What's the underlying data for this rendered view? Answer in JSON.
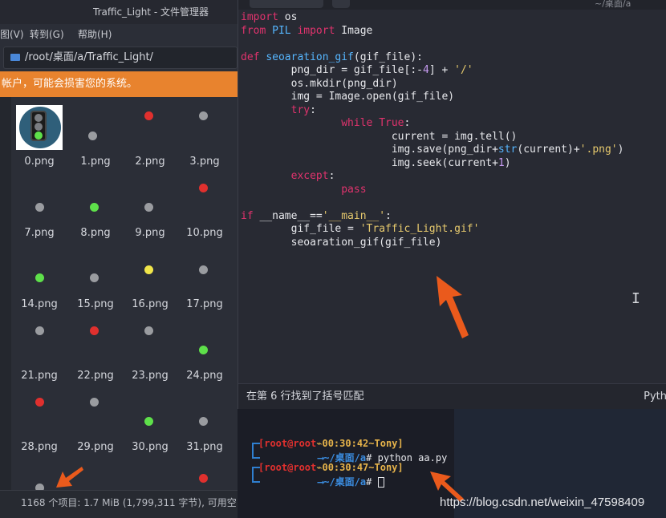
{
  "file_manager": {
    "title": "Traffic_Light - 文件管理器",
    "menu": [
      "图(V)",
      "转到(G)",
      "帮助(H)"
    ],
    "path": "/root/桌面/a/Traffic_Light/",
    "warning": "帐户，可能会损害您的系统。",
    "files": [
      {
        "name": "0.png",
        "thumb": "traffic-light"
      },
      {
        "name": "1.png",
        "dot": "gray"
      },
      {
        "name": "2.png",
        "dot": "red"
      },
      {
        "name": "3.png",
        "dot": "gray"
      },
      {
        "name": "7.png",
        "dot": "gray"
      },
      {
        "name": "8.png",
        "dot": "green"
      },
      {
        "name": "9.png",
        "dot": "gray"
      },
      {
        "name": "10.png",
        "dot": "red"
      },
      {
        "name": "14.png",
        "dot": "green"
      },
      {
        "name": "15.png",
        "dot": "gray"
      },
      {
        "name": "16.png",
        "dot": "yellow"
      },
      {
        "name": "17.png",
        "dot": "gray"
      },
      {
        "name": "21.png",
        "dot": "gray"
      },
      {
        "name": "22.png",
        "dot": "red"
      },
      {
        "name": "23.png",
        "dot": "gray"
      },
      {
        "name": "24.png",
        "dot": "green"
      },
      {
        "name": "28.png",
        "dot": "red"
      },
      {
        "name": "29.png",
        "dot": "gray"
      },
      {
        "name": "30.png",
        "dot": "green"
      },
      {
        "name": "31.png",
        "dot": "gray"
      }
    ],
    "status": "1168 个项目: 1.7 MiB (1,799,311 字节), 可用空"
  },
  "colors": {
    "gray": "#9a9ca0",
    "red": "#e0302e",
    "green": "#5ee04a",
    "yellow": "#f1e64a",
    "warning_bg": "#e8832e"
  },
  "editor": {
    "path_hint": "~/桌面/a",
    "code": [
      [
        [
          "kw",
          "import"
        ],
        [
          "t",
          " os"
        ]
      ],
      [
        [
          "kw",
          "from"
        ],
        [
          "t",
          " "
        ],
        [
          "bi",
          "PIL"
        ],
        [
          "t",
          " "
        ],
        [
          "kw",
          "import"
        ],
        [
          "t",
          " Image"
        ]
      ],
      [],
      [
        [
          "kw",
          "def"
        ],
        [
          "t",
          " "
        ],
        [
          "fn",
          "seoaration_gif"
        ],
        [
          "t",
          "(gif_file):"
        ]
      ],
      [
        [
          "t",
          "        png_dir = gif_file[:-"
        ],
        [
          "num",
          "4"
        ],
        [
          "t",
          "] + "
        ],
        [
          "str",
          "'/'"
        ]
      ],
      [
        [
          "t",
          "        os.mkdir(png_dir)"
        ]
      ],
      [
        [
          "t",
          "        img = Image.open(gif_file)"
        ]
      ],
      [
        [
          "t",
          "        "
        ],
        [
          "kw",
          "try"
        ],
        [
          "t",
          ":"
        ]
      ],
      [
        [
          "t",
          "                "
        ],
        [
          "kw",
          "while"
        ],
        [
          "t",
          " "
        ],
        [
          "kw",
          "True"
        ],
        [
          "t",
          ":"
        ]
      ],
      [
        [
          "t",
          "                        current = img.tell()"
        ]
      ],
      [
        [
          "t",
          "                        img.save(png_dir+"
        ],
        [
          "bi",
          "str"
        ],
        [
          "t",
          "(current)+"
        ],
        [
          "str",
          "'.png'"
        ],
        [
          "t",
          ")"
        ]
      ],
      [
        [
          "t",
          "                        img.seek(current+"
        ],
        [
          "num",
          "1"
        ],
        [
          "t",
          ")"
        ]
      ],
      [
        [
          "t",
          "        "
        ],
        [
          "kw",
          "except"
        ],
        [
          "t",
          ":"
        ]
      ],
      [
        [
          "t",
          "                "
        ],
        [
          "kw",
          "pass"
        ]
      ],
      [],
      [
        [
          "kw",
          "if"
        ],
        [
          "t",
          " __name__=="
        ],
        [
          "str",
          "'__main__'"
        ],
        [
          "t",
          ":"
        ]
      ],
      [
        [
          "t",
          "        gif_file = "
        ],
        [
          "str",
          "'Traffic_Light.gif'"
        ]
      ],
      [
        [
          "t",
          "        seoaration_gif(gif_file)"
        ]
      ]
    ],
    "status_message": "在第 6 行找到了括号匹配",
    "status_lang": "Pyth"
  },
  "terminal": {
    "prompt1": {
      "user": "[root@root",
      "time": "00:30:42",
      "name": "~Tony]",
      "path": "~/桌面/a",
      "hash": "#",
      "cmd": " python aa.py"
    },
    "prompt2": {
      "user": "[root@root",
      "time": "00:30:47",
      "name": "~Tony]",
      "path": "~/桌面/a",
      "hash": "#",
      "cmd": " "
    }
  },
  "watermark": "https://blog.csdn.net/weixin_47598409"
}
